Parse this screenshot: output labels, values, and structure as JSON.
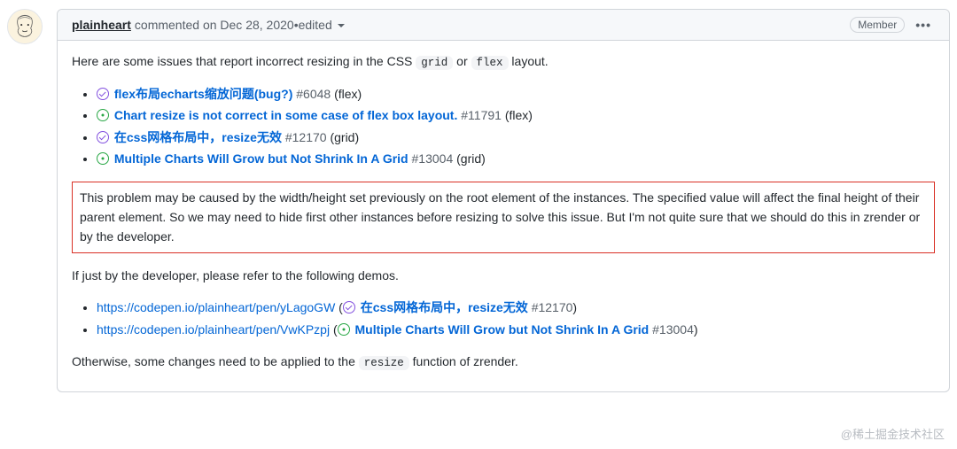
{
  "header": {
    "author": "plainheart",
    "commented": " commented on Dec 28, 2020 ",
    "dot": "•",
    "edited": " edited ",
    "badge": "Member"
  },
  "body": {
    "intro_a": "Here are some issues that report incorrect resizing in the CSS ",
    "code_grid": "grid",
    "intro_b": " or ",
    "code_flex": "flex",
    "intro_c": " layout.",
    "issues": [
      {
        "state": "closed",
        "title": "flex布局echarts缩放问题(bug?)",
        "num": " #6048",
        "suffix": " (flex)"
      },
      {
        "state": "open",
        "title": "Chart resize is not correct in some case of flex box layout.",
        "num": " #11791",
        "suffix": " (flex)"
      },
      {
        "state": "closed",
        "title": "在css网格布局中，resize无效",
        "num": " #12170",
        "suffix": " (grid)"
      },
      {
        "state": "open",
        "title": "Multiple Charts Will Grow but Not Shrink In A Grid",
        "num": " #13004",
        "suffix": " (grid)"
      }
    ],
    "highlight": "This problem may be caused by the width/height set previously on the root element of the instances. The specified value will affect the final height of their parent element. So we may need to hide first other instances before resizing to solve this issue. But I'm not quite sure that we should do this in zrender or by the developer.",
    "demos_intro": "If just by the developer, please refer to the following demos.",
    "demos": [
      {
        "url": "https://codepen.io/plainheart/pen/yLagoGW",
        "open_paren": " (",
        "state": "closed",
        "title": "在css网格布局中，resize无效",
        "num": " #12170",
        "close_paren": ")"
      },
      {
        "url": "https://codepen.io/plainheart/pen/VwKPzpj",
        "open_paren": " (",
        "state": "open",
        "title": "Multiple Charts Will Grow but Not Shrink In A Grid",
        "num": " #13004",
        "close_paren": ")"
      }
    ],
    "otherwise_a": "Otherwise, some changes need to be applied to the ",
    "code_resize": "resize",
    "otherwise_b": " function of zrender."
  },
  "watermark": "@稀土掘金技术社区"
}
